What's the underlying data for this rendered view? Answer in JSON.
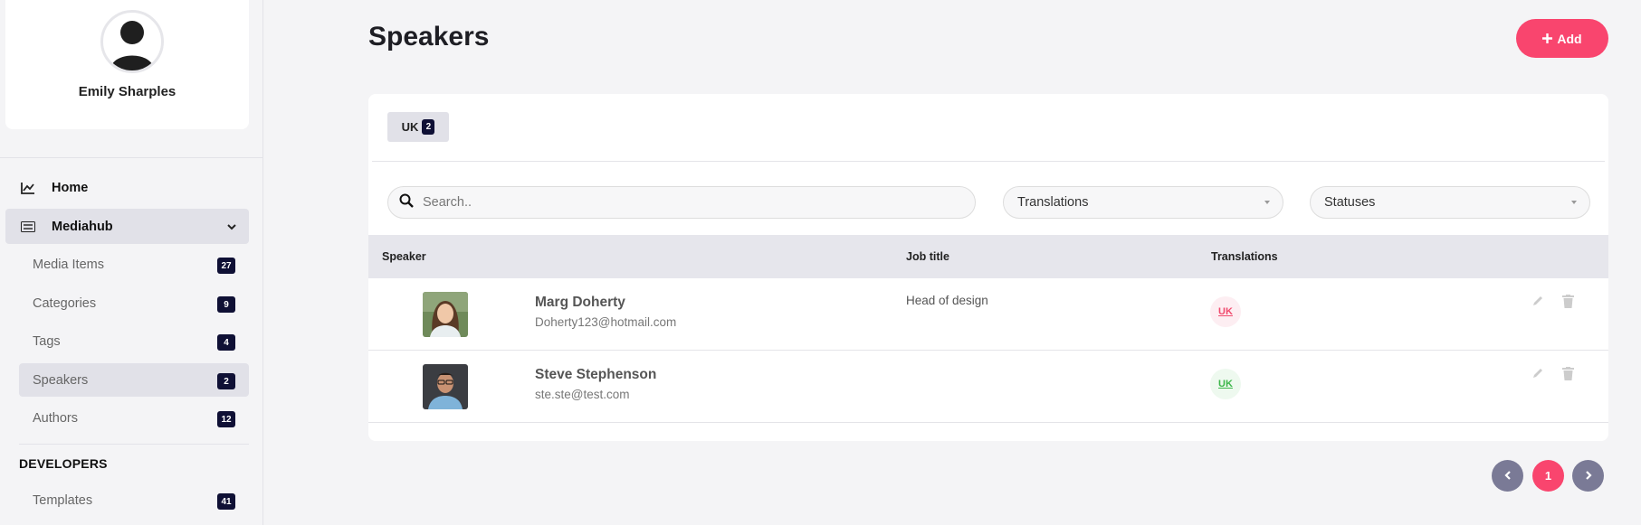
{
  "sidebar": {
    "profile": {
      "name": "Emily Sharples"
    },
    "nav": {
      "home": "Home",
      "mediahub": "Mediahub",
      "items": [
        {
          "label": "Media Items",
          "count": "27"
        },
        {
          "label": "Categories",
          "count": "9"
        },
        {
          "label": "Tags",
          "count": "4"
        },
        {
          "label": "Speakers",
          "count": "2"
        },
        {
          "label": "Authors",
          "count": "12"
        }
      ],
      "developers_label": "DEVELOPERS",
      "templates": {
        "label": "Templates",
        "count": "41"
      }
    }
  },
  "main": {
    "title": "Speakers",
    "add_label": "Add",
    "tab": {
      "label": "UK",
      "count": "2"
    },
    "search_placeholder": "Search..",
    "filters": {
      "translations": "Translations",
      "statuses": "Statuses"
    },
    "columns": {
      "speaker": "Speaker",
      "job_title": "Job title",
      "translations": "Translations"
    },
    "rows": [
      {
        "name": "Marg Doherty",
        "email": "Doherty123@hotmail.com",
        "job_title": "Head of design",
        "translation": "UK",
        "translation_status_color": "#f04b6e"
      },
      {
        "name": "Steve Stephenson",
        "email": "ste.ste@test.com",
        "job_title": "",
        "translation": "UK",
        "translation_status_color": "#3cb64a"
      }
    ],
    "pagination": {
      "current": "1"
    }
  },
  "colors": {
    "accent": "#f9456e",
    "badge": "#0f1035",
    "pager": "#7a7a96"
  }
}
